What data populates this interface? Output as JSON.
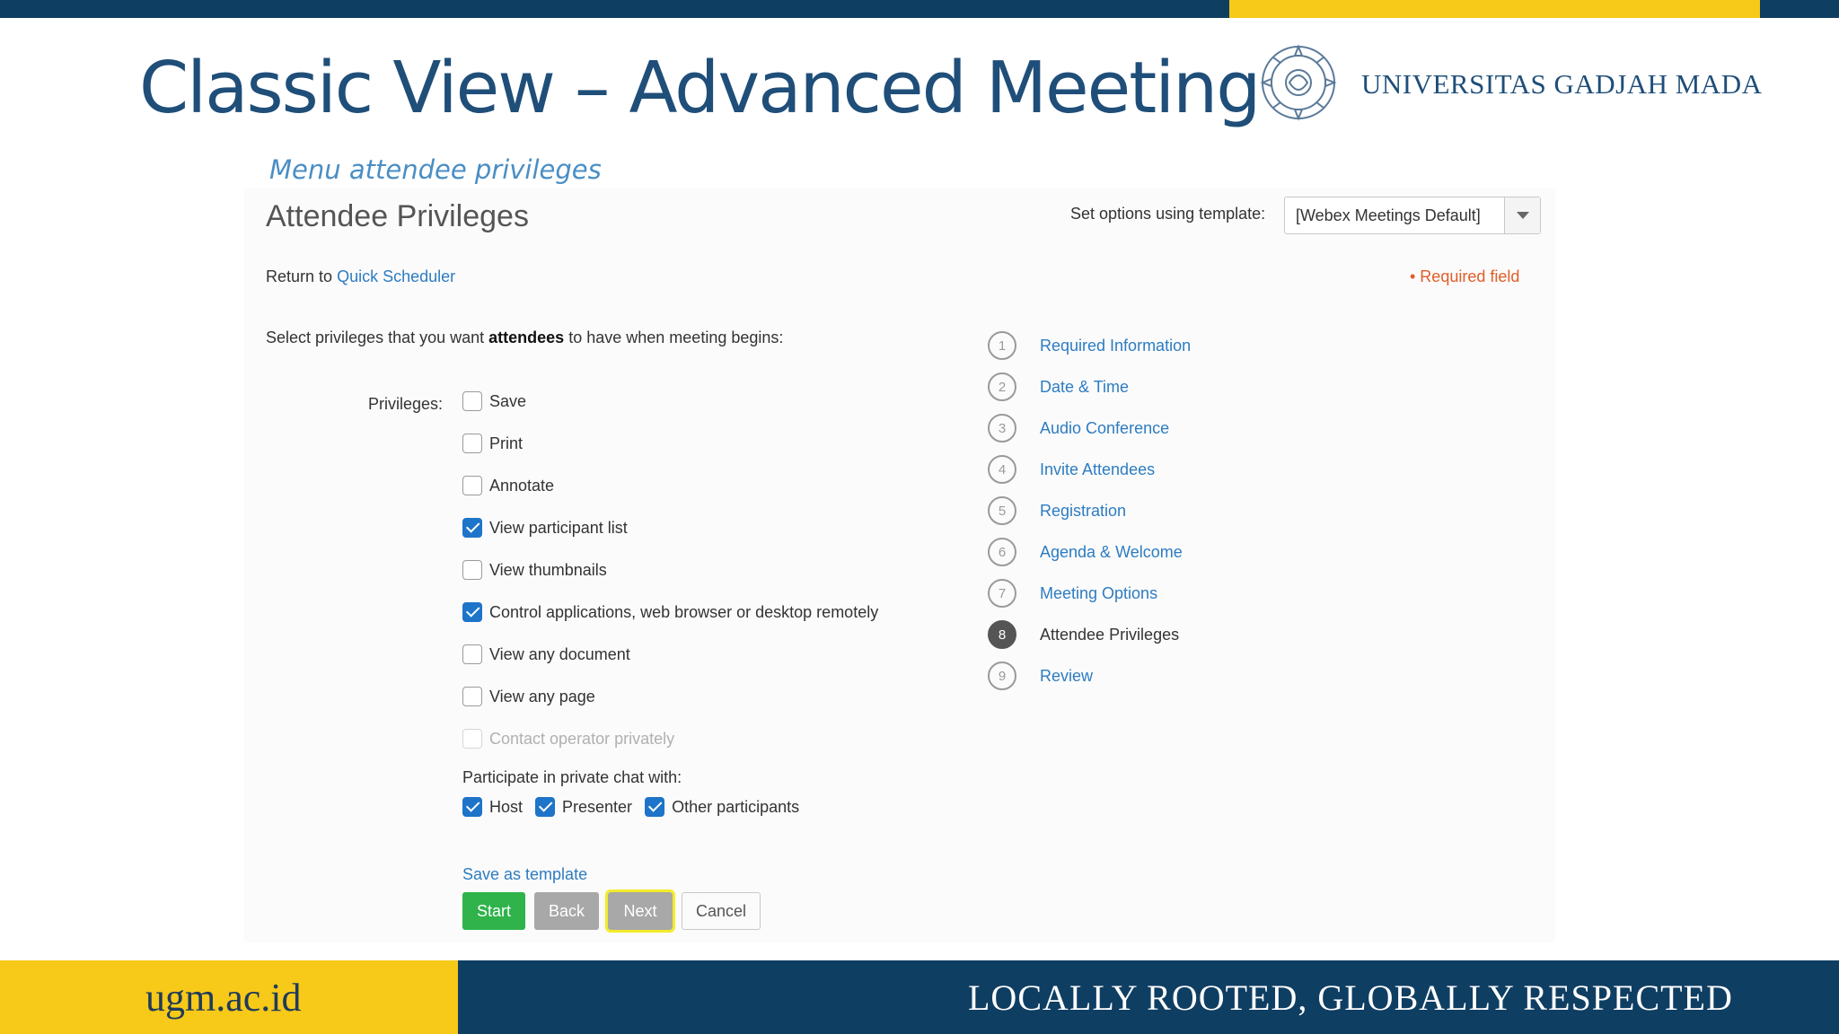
{
  "slide": {
    "title": "Classic View – Advanced Meeting",
    "subtitle": "Menu attendee privileges",
    "university": "UNIVERSITAS GADJAH MADA",
    "footer_domain": "ugm.ac.id",
    "footer_tagline": "LOCALLY ROOTED, GLOBALLY RESPECTED",
    "colors": {
      "navy": "#0f3e63",
      "yellow": "#f7c918",
      "title_blue": "#1f4e79"
    }
  },
  "form": {
    "heading": "Attendee Privileges",
    "template_label": "Set options using template:",
    "template_value": "[Webex Meetings Default]",
    "return_prefix": "Return to",
    "return_link": "Quick Scheduler",
    "required_note": "• Required field",
    "instruction_prefix": "Select privileges that you want",
    "instruction_bold": "attendees",
    "instruction_suffix": "to have when meeting begins:",
    "privileges_label": "Privileges:",
    "privileges": [
      {
        "label": "Save",
        "checked": false,
        "disabled": false
      },
      {
        "label": "Print",
        "checked": false,
        "disabled": false
      },
      {
        "label": "Annotate",
        "checked": false,
        "disabled": false
      },
      {
        "label": "View participant list",
        "checked": true,
        "disabled": false
      },
      {
        "label": "View thumbnails",
        "checked": false,
        "disabled": false
      },
      {
        "label": "Control applications, web browser or desktop remotely",
        "checked": true,
        "disabled": false
      },
      {
        "label": "View any document",
        "checked": false,
        "disabled": false
      },
      {
        "label": "View any page",
        "checked": false,
        "disabled": false
      },
      {
        "label": "Contact operator privately",
        "checked": false,
        "disabled": true
      }
    ],
    "chat_label": "Participate in private chat with:",
    "chat_options": [
      {
        "label": "Host",
        "checked": true
      },
      {
        "label": "Presenter",
        "checked": true
      },
      {
        "label": "Other participants",
        "checked": true
      }
    ],
    "save_template": "Save as template",
    "buttons": {
      "start": "Start",
      "back": "Back",
      "next": "Next",
      "cancel": "Cancel"
    },
    "button_colors": {
      "start": "#2fb34a",
      "disabled": "#a8a8a8",
      "next_highlight": "#f3ec2a"
    }
  },
  "steps": [
    {
      "num": "1",
      "label": "Required Information",
      "active": false
    },
    {
      "num": "2",
      "label": "Date & Time",
      "active": false
    },
    {
      "num": "3",
      "label": "Audio Conference",
      "active": false
    },
    {
      "num": "4",
      "label": "Invite Attendees",
      "active": false
    },
    {
      "num": "5",
      "label": "Registration",
      "active": false
    },
    {
      "num": "6",
      "label": "Agenda & Welcome",
      "active": false
    },
    {
      "num": "7",
      "label": "Meeting Options",
      "active": false
    },
    {
      "num": "8",
      "label": "Attendee Privileges",
      "active": true
    },
    {
      "num": "9",
      "label": "Review",
      "active": false
    }
  ]
}
